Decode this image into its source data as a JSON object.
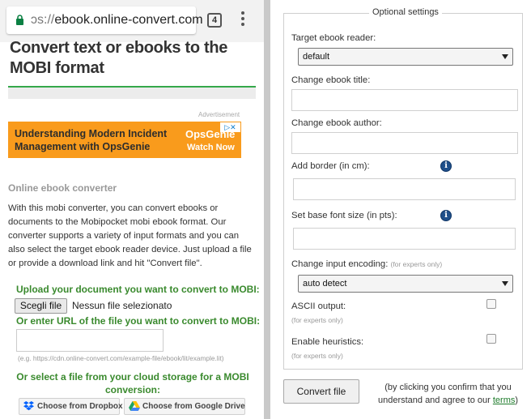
{
  "browser": {
    "url_prefix": "ɔs://",
    "url_domain": "ebook.online-convert.com",
    "tab_count": "4"
  },
  "page": {
    "title": "Convert text or ebooks to the MOBI format",
    "advertisement_label": "Advertisement",
    "ad": {
      "text": "Understanding Modern Incident Management with OpsGenie",
      "brand": "OpsGenie",
      "cta": "Watch Now",
      "close_label": "▷✕"
    },
    "section_heading": "Online ebook converter",
    "intro": "With this mobi converter, you can convert ebooks or documents to the Mobipocket mobi ebook format. Our converter supports a variety of input formats and you can also select the target ebook reader device. Just upload a file or provide a download link and hit \"Convert file\".",
    "upload_label": "Upload your document you want to convert to MOBI:",
    "choose_file_label": "Scegli file",
    "no_file_text": "Nessun file selezionato",
    "url_label": "Or enter URL of the file you want to convert to MOBI:",
    "url_example": "(e.g. https://cdn.online-convert.com/example-file/ebook/lit/example.lit)",
    "cloud_label": "Or select a file from your cloud storage for a MOBI conversion:",
    "dropbox_label": "Choose from Dropbox",
    "gdrive_label": "Choose from Google Drive"
  },
  "settings": {
    "legend": "Optional settings",
    "target_reader_label": "Target ebook reader:",
    "target_reader_value": "default",
    "title_label": "Change ebook title:",
    "author_label": "Change ebook author:",
    "border_label": "Add border (in cm):",
    "font_size_label": "Set base font size (in pts):",
    "encoding_label": "Change input encoding:",
    "encoding_hint": "(for experts only)",
    "encoding_value": "auto detect",
    "ascii_label": "ASCII output:",
    "ascii_hint": "(for experts only)",
    "heuristics_label": "Enable heuristics:",
    "heuristics_hint": "(for experts only)",
    "convert_label": "Convert file",
    "terms_prefix": "(by clicking you confirm that you understand and agree to our ",
    "terms_link": "terms",
    "terms_suffix": ")"
  },
  "colors": {
    "accent_green": "#3a8a2e",
    "ad_orange": "#f99b1c",
    "info_blue": "#1f4f8a"
  }
}
